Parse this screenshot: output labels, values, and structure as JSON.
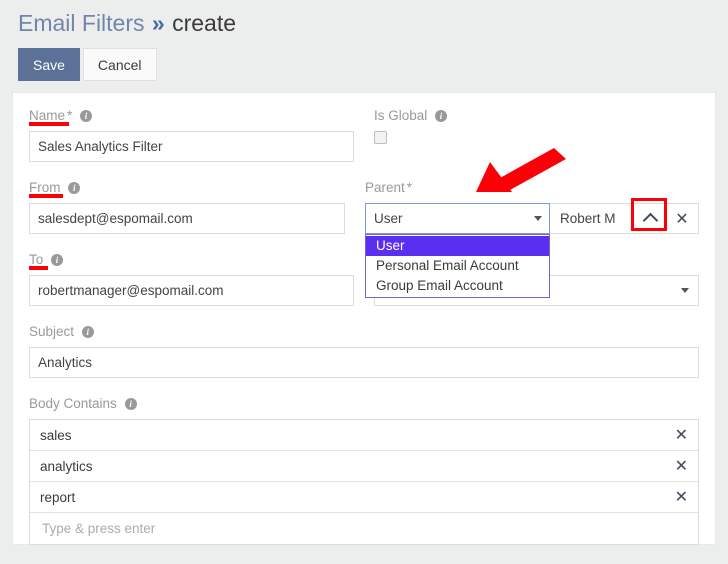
{
  "header": {
    "breadcrumb_parent": "Email Filters",
    "breadcrumb_separator": "»",
    "breadcrumb_current": "create"
  },
  "toolbar": {
    "save_label": "Save",
    "cancel_label": "Cancel"
  },
  "form": {
    "name": {
      "label": "Name",
      "required_mark": "*",
      "value": "Sales Analytics Filter"
    },
    "is_global": {
      "label": "Is Global",
      "checked": false
    },
    "from": {
      "label": "From",
      "value": "salesdept@espomail.com"
    },
    "parent": {
      "label": "Parent",
      "required_mark": "*",
      "type_selected": "User",
      "type_options": [
        "User",
        "Personal Email Account",
        "Group Email Account"
      ],
      "dropdown_open": true,
      "record_value": "Robert M",
      "collapse_icon": "chevron-up-icon",
      "clear_icon": "close-x-icon"
    },
    "to": {
      "label": "To",
      "value": "robertmanager@espomail.com"
    },
    "subject": {
      "label": "Subject",
      "value": "Analytics"
    },
    "body_contains": {
      "label": "Body Contains",
      "items": [
        "sales",
        "analytics",
        "report"
      ],
      "input_placeholder": "Type & press enter",
      "remove_icon": "close-x-icon"
    }
  },
  "annotations": {
    "arrow_color": "#fb0007",
    "highlight_color": "#fb0007"
  },
  "colors": {
    "accent_primary": "#5b7198",
    "breadcrumb_link": "#7287a8",
    "dropdown_highlight": "#5b2ff0",
    "label_text": "#999999",
    "page_background": "#eceded"
  }
}
